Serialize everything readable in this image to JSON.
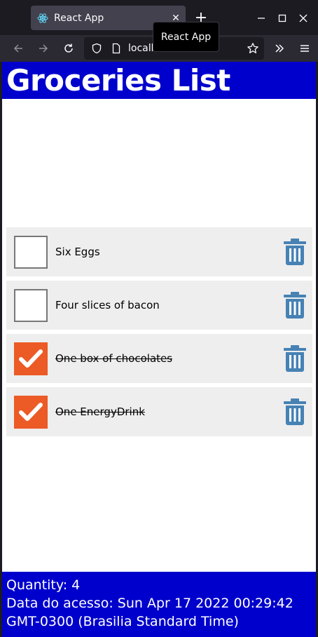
{
  "browser": {
    "tab_title": "React App",
    "tab_close": "✕",
    "new_tab": "+",
    "tooltip": "React App",
    "url": "localhost:3000"
  },
  "app": {
    "title": "Groceries List",
    "items": [
      {
        "label": "Six Eggs",
        "checked": false
      },
      {
        "label": "Four slices of bacon",
        "checked": false
      },
      {
        "label": "One box of chocolates",
        "checked": true
      },
      {
        "label": "One EnergyDrink",
        "checked": true
      }
    ],
    "footer": {
      "quantity": "Quantity: 4",
      "access_line1": "Data do acesso: Sun Apr 17 2022 00:29:42",
      "access_line2": "GMT-0300 (Brasilia Standard Time)"
    }
  },
  "colors": {
    "header_bg": "#0000cc",
    "checkbox_checked": "#ec5a25",
    "trash_icon": "#4682b4",
    "item_bg": "#eeeeee"
  }
}
